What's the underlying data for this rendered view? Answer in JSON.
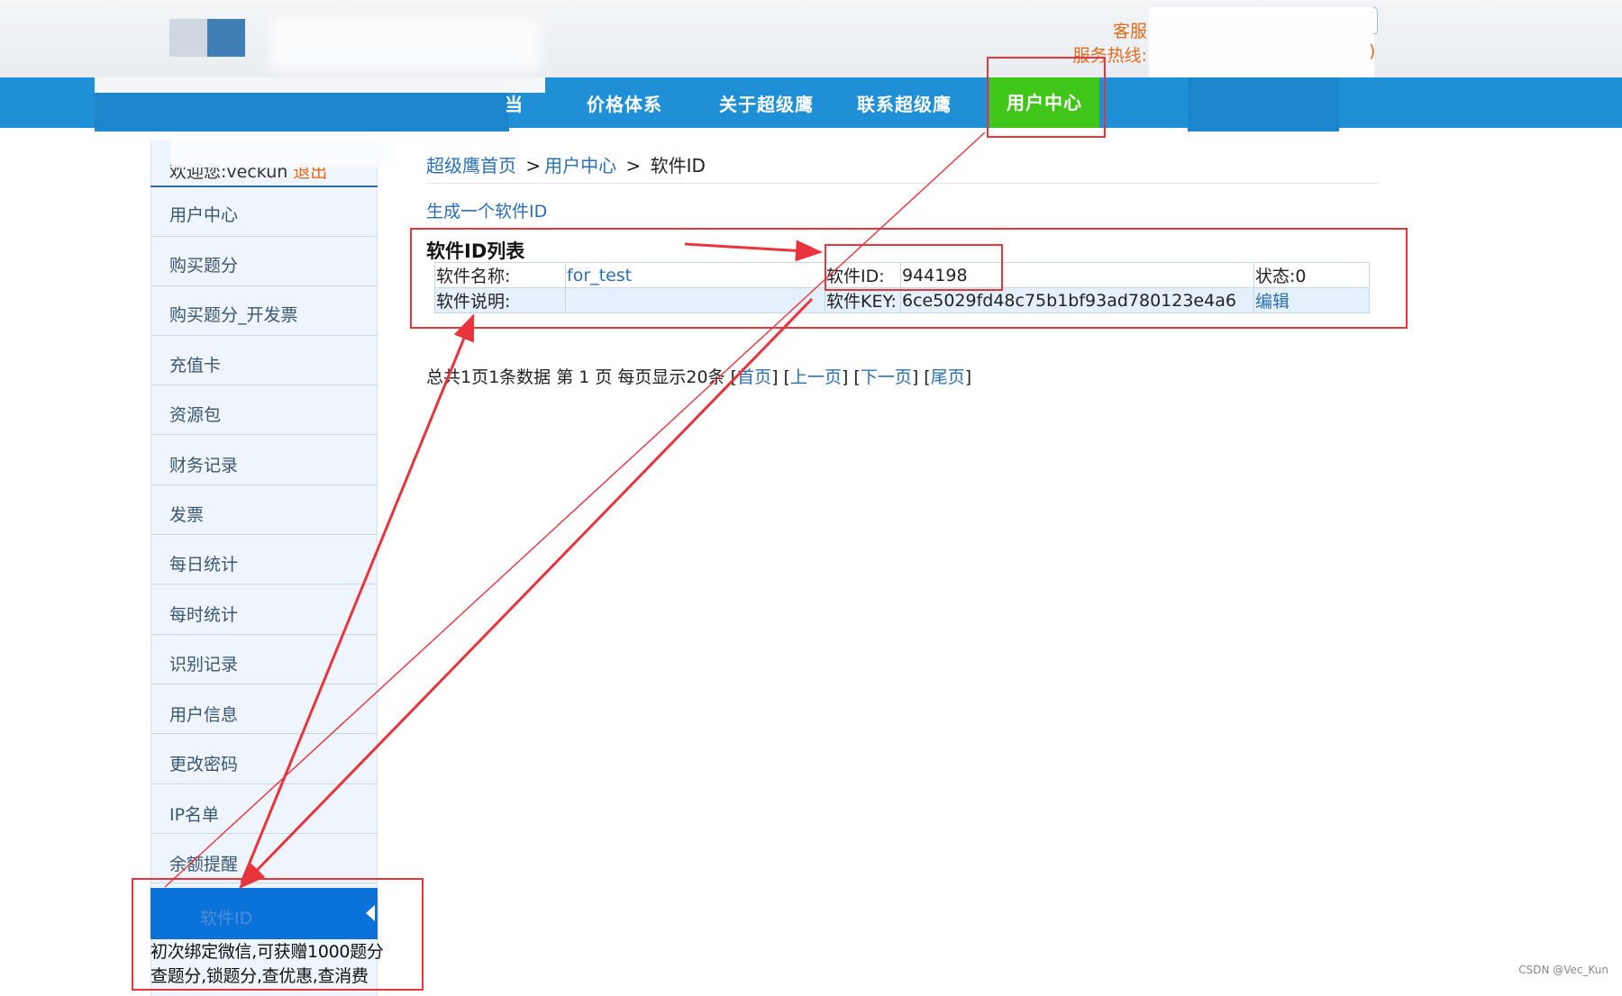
{
  "header": {
    "contact_label": "客服",
    "hotline_label": "服务热线:",
    "hotline_tail": ")"
  },
  "nav": {
    "partial_item": "当",
    "items": [
      "价格体系",
      "关于超级鹰",
      "联系超级鹰"
    ],
    "active_item": "用户中心"
  },
  "sidebar": {
    "welcome_text": "欢迎您:veckun",
    "logout_label": "退出",
    "items": [
      "用户中心",
      "购买题分",
      "购买题分_开发票",
      "充值卡",
      "资源包",
      "财务记录",
      "发票",
      "每日统计",
      "每时统计",
      "识别记录",
      "用户信息",
      "更改密码",
      "IP名单",
      "余额提醒"
    ],
    "active_item": "软件ID",
    "wechat_line1": "初次绑定微信,可获赠1000题分",
    "wechat_line2": "查题分,锁题分,查优惠,查消费"
  },
  "main": {
    "breadcrumb": {
      "home": "超级鹰首页",
      "sep1": ">",
      "user_center": "用户中心",
      "sep2": ">",
      "current": "软件ID"
    },
    "generate_link": "生成一个软件ID",
    "list_title": "软件ID列表",
    "table": {
      "name_label": "软件名称:",
      "name_value": "for_test",
      "id_label": "软件ID:",
      "id_value": "944198",
      "status_text": "状态:0",
      "desc_label": "软件说明:",
      "desc_value": "",
      "key_label": "软件KEY:",
      "key_value": "6ce5029fd48c75b1bf93ad780123e4a6",
      "edit_link": "编辑"
    },
    "pager": {
      "summary": "总共1页1条数据 第 1 页 每页显示20条",
      "first": "首页",
      "prev": "上一页",
      "next": "下一页",
      "last": "尾页"
    }
  },
  "watermark": "CSDN @Vec_Kun",
  "colors": {
    "nav_blue": "#1f8fd6",
    "nav_active_green": "#3fc618",
    "link_blue": "#2a6fb5",
    "sidebar_active": "#0a72d8",
    "annotation_red": "#e8343c",
    "accent_orange": "#e46a1c"
  }
}
